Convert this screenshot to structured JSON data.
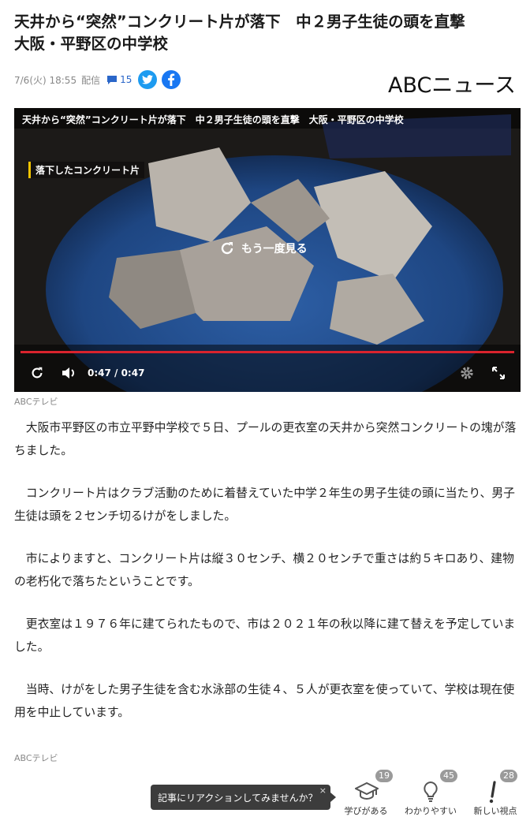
{
  "article": {
    "headline_line1": "天井から“突然”コンクリート片が落下　中２男子生徒の頭を直撃",
    "headline_line2": "大阪・平野区の中学校",
    "date": "7/6(火) 18:55",
    "status": "配信",
    "comment_count": "15",
    "publisher_logo": "ABCニュース",
    "photo_credit": "ABCテレビ",
    "paragraphs": [
      "大阪市平野区の市立平野中学校で５日、プールの更衣室の天井から突然コンクリートの塊が落ちました。",
      "コンクリート片はクラブ活動のために着替えていた中学２年生の男子生徒の頭に当たり、男子生徒は頭を２センチ切るけがをしました。",
      "市によりますと、コンクリート片は縦３０センチ、横２０センチで重さは約５キロあり、建物の老朽化で落ちたということです。",
      "更衣室は１９７６年に建てられたもので、市は２０２１年の秋以降に建て替えを予定していました。",
      "当時、けがをした男子生徒を含む水泳部の生徒４、５人が更衣室を使っていて、学校は現在使用を中止しています。"
    ],
    "footer_credit": "ABCテレビ"
  },
  "video": {
    "title": "天井から“突然”コンクリート片が落下　中２男子生徒の頭を直撃　大阪・平野区の中学校",
    "overlay_tag": "落下したコンクリート片",
    "replay_label": "もう一度見る",
    "time": "0:47 / 0:47",
    "progress": 1.0
  },
  "reactions": {
    "prompt": "記事にリアクションしてみませんか？",
    "close_glyph": "×",
    "items": [
      {
        "label": "学びがある",
        "count": "19",
        "icon": "graduation-cap-icon"
      },
      {
        "label": "わかりやすい",
        "count": "45",
        "icon": "lightbulb-icon"
      },
      {
        "label": "新しい視点",
        "count": "28",
        "icon": "exclamation-icon"
      }
    ]
  },
  "colors": {
    "accent_blue": "#2a66c9",
    "twitter": "#1d9bf0",
    "facebook": "#1877f2",
    "progress_red": "#d9232d"
  }
}
